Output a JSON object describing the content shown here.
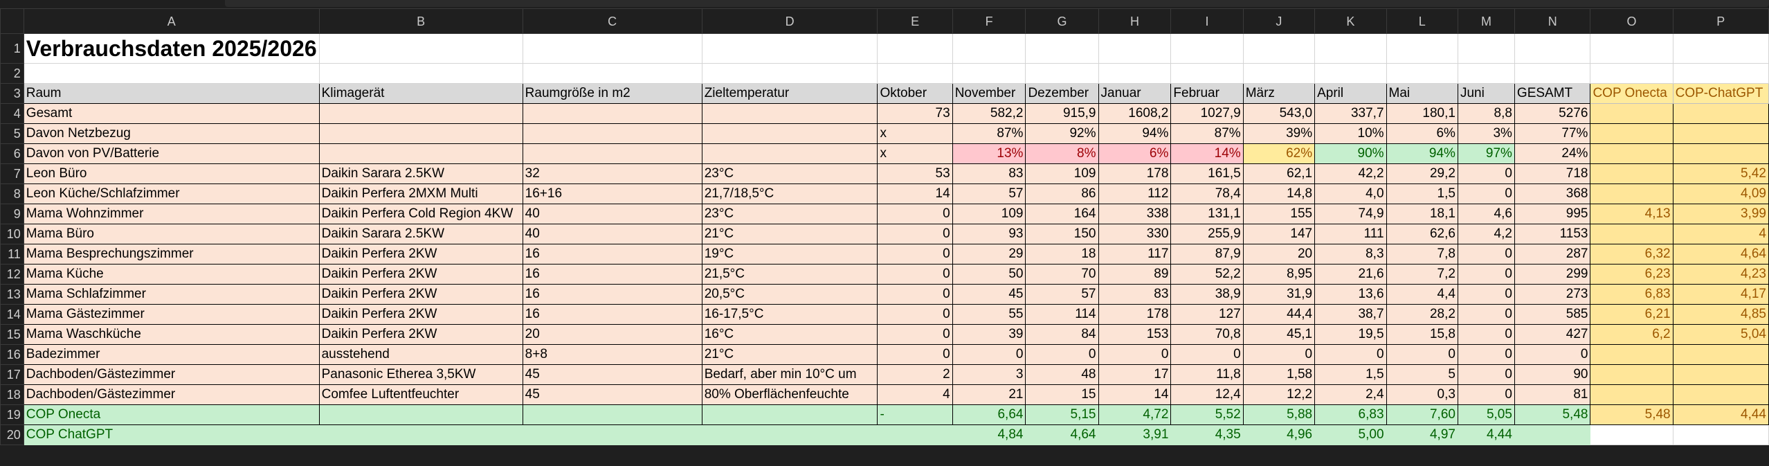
{
  "columns": [
    "A",
    "B",
    "C",
    "D",
    "E",
    "F",
    "G",
    "H",
    "I",
    "J",
    "K",
    "L",
    "M",
    "N",
    "O",
    "P"
  ],
  "row_numbers": [
    "1",
    "2",
    "3",
    "4",
    "5",
    "6",
    "7",
    "8",
    "9",
    "10",
    "11",
    "12",
    "13",
    "14",
    "15",
    "16",
    "17",
    "18",
    "19",
    "20"
  ],
  "title": "Verbrauchsdaten 2025/2026",
  "headers": [
    "Raum",
    "Klimagerät",
    "Raumgröße in m2",
    "Zieltemperatur",
    "Oktober",
    "November",
    "Dezember",
    "Januar",
    "Februar",
    "März",
    "April",
    "Mai",
    "Juni",
    "GESAMT",
    "COP Onecta",
    "COP-ChatGPT"
  ],
  "rows": [
    {
      "a": "Gesamt",
      "b": "",
      "c": "",
      "d": "",
      "e": "73",
      "f": "582,2",
      "g": "915,9",
      "h": "1608,2",
      "i": "1027,9",
      "j": "543,0",
      "k": "337,7",
      "l": "180,1",
      "m": "8,8",
      "n": "5276",
      "o": "",
      "p": ""
    },
    {
      "a": "Davon Netzbezug",
      "b": "",
      "c": "",
      "d": "",
      "e": "x",
      "f": "87%",
      "g": "92%",
      "h": "94%",
      "i": "87%",
      "j": "39%",
      "k": "10%",
      "l": "6%",
      "m": "3%",
      "n": "77%",
      "o": "",
      "p": ""
    },
    {
      "a": "Davon von PV/Batterie",
      "b": "",
      "c": "",
      "d": "",
      "e": "x",
      "f": "13%",
      "g": "8%",
      "h": "6%",
      "i": "14%",
      "j": "62%",
      "k": "90%",
      "l": "94%",
      "m": "97%",
      "n": "24%",
      "o": "",
      "p": ""
    },
    {
      "a": "Leon Büro",
      "b": "Daikin Sarara 2.5KW",
      "c": "32",
      "d": "23°C",
      "e": "53",
      "f": "83",
      "g": "109",
      "h": "178",
      "i": "161,5",
      "j": "62,1",
      "k": "42,2",
      "l": "29,2",
      "m": "0",
      "n": "718",
      "o": "",
      "p": "5,42"
    },
    {
      "a": "Leon Küche/Schlafzimmer",
      "b": "Daikin Perfera 2MXM Multi",
      "c": "16+16",
      "d": "21,7/18,5°C",
      "e": "14",
      "f": "57",
      "g": "86",
      "h": "112",
      "i": "78,4",
      "j": "14,8",
      "k": "4,0",
      "l": "1,5",
      "m": "0",
      "n": "368",
      "o": "",
      "p": "4,09"
    },
    {
      "a": "Mama Wohnzimmer",
      "b": "Daikin Perfera Cold Region 4KW",
      "c": "40",
      "d": "23°C",
      "e": "0",
      "f": "109",
      "g": "164",
      "h": "338",
      "i": "131,1",
      "j": "155",
      "k": "74,9",
      "l": "18,1",
      "m": "4,6",
      "n": "995",
      "o": "4,13",
      "p": "3,99"
    },
    {
      "a": "Mama Büro",
      "b": "Daikin Sarara 2.5KW",
      "c": "40",
      "d": "21°C",
      "e": "0",
      "f": "93",
      "g": "150",
      "h": "330",
      "i": "255,9",
      "j": "147",
      "k": "111",
      "l": "62,6",
      "m": "4,2",
      "n": "1153",
      "o": "",
      "p": "4"
    },
    {
      "a": "Mama Besprechungszimmer",
      "b": "Daikin Perfera 2KW",
      "c": "16",
      "d": "19°C",
      "e": "0",
      "f": "29",
      "g": "18",
      "h": "117",
      "i": "87,9",
      "j": "20",
      "k": "8,3",
      "l": "7,8",
      "m": "0",
      "n": "287",
      "o": "6,32",
      "p": "4,64"
    },
    {
      "a": "Mama Küche",
      "b": "Daikin Perfera 2KW",
      "c": "16",
      "d": "21,5°C",
      "e": "0",
      "f": "50",
      "g": "70",
      "h": "89",
      "i": "52,2",
      "j": "8,95",
      "k": "21,6",
      "l": "7,2",
      "m": "0",
      "n": "299",
      "o": "6,23",
      "p": "4,23"
    },
    {
      "a": "Mama Schlafzimmer",
      "b": "Daikin Perfera 2KW",
      "c": "16",
      "d": "20,5°C",
      "e": "0",
      "f": "45",
      "g": "57",
      "h": "83",
      "i": "38,9",
      "j": "31,9",
      "k": "13,6",
      "l": "4,4",
      "m": "0",
      "n": "273",
      "o": "6,83",
      "p": "4,17"
    },
    {
      "a": "Mama Gästezimmer",
      "b": "Daikin Perfera 2KW",
      "c": "16",
      "d": "16-17,5°C",
      "e": "0",
      "f": "55",
      "g": "114",
      "h": "178",
      "i": "127",
      "j": "44,4",
      "k": "38,7",
      "l": "28,2",
      "m": "0",
      "n": "585",
      "o": "6,21",
      "p": "4,85"
    },
    {
      "a": "Mama Waschküche",
      "b": "Daikin Perfera 2KW",
      "c": "20",
      "d": "16°C",
      "e": "0",
      "f": "39",
      "g": "84",
      "h": "153",
      "i": "70,8",
      "j": "45,1",
      "k": "19,5",
      "l": "15,8",
      "m": "0",
      "n": "427",
      "o": "6,2",
      "p": "5,04"
    },
    {
      "a": "Badezimmer",
      "b": "ausstehend",
      "c": "8+8",
      "d": "21°C",
      "e": "0",
      "f": "0",
      "g": "0",
      "h": "0",
      "i": "0",
      "j": "0",
      "k": "0",
      "l": "0",
      "m": "0",
      "n": "0",
      "o": "",
      "p": ""
    },
    {
      "a": "Dachboden/Gästezimmer",
      "b": "Panasonic Etherea 3,5KW",
      "c": "45",
      "d": "Bedarf, aber min 10°C um",
      "e": "2",
      "f": "3",
      "g": "48",
      "h": "17",
      "i": "11,8",
      "j": "1,58",
      "k": "1,5",
      "l": "5",
      "m": "0",
      "n": "90",
      "o": "",
      "p": ""
    },
    {
      "a": "Dachboden/Gästezimmer",
      "b": "Comfee Luftentfeuchter",
      "c": "45",
      "d": "80% Oberflächenfeuchte",
      "e": "4",
      "f": "21",
      "g": "15",
      "h": "14",
      "i": "12,4",
      "j": "12,2",
      "k": "2,4",
      "l": "0,3",
      "m": "0",
      "n": "81",
      "o": "",
      "p": ""
    },
    {
      "a": "COP Onecta",
      "b": "",
      "c": "",
      "d": "",
      "e": "-",
      "f": "6,64",
      "g": "5,15",
      "h": "4,72",
      "i": "5,52",
      "j": "5,88",
      "k": "6,83",
      "l": "7,60",
      "m": "5,05",
      "n": "5,48",
      "o": "5,48",
      "p": "4,44"
    },
    {
      "a": "COP ChatGPT",
      "b": "",
      "c": "",
      "d": "",
      "e": "",
      "f": "4,84",
      "g": "4,64",
      "h": "3,91",
      "i": "4,35",
      "j": "4,96",
      "k": "5,00",
      "l": "4,97",
      "m": "4,44",
      "n": "",
      "o": "",
      "p": ""
    }
  ],
  "colors": {
    "pink": "#fce4d6",
    "green_fill": "#c6efce",
    "green_text": "#006100",
    "yellow_fill": "#ffe699",
    "yellow_text": "#9c5700",
    "red_fill": "#ffc7ce",
    "red_text": "#9c0006",
    "header_gray": "#d9d9d9"
  }
}
